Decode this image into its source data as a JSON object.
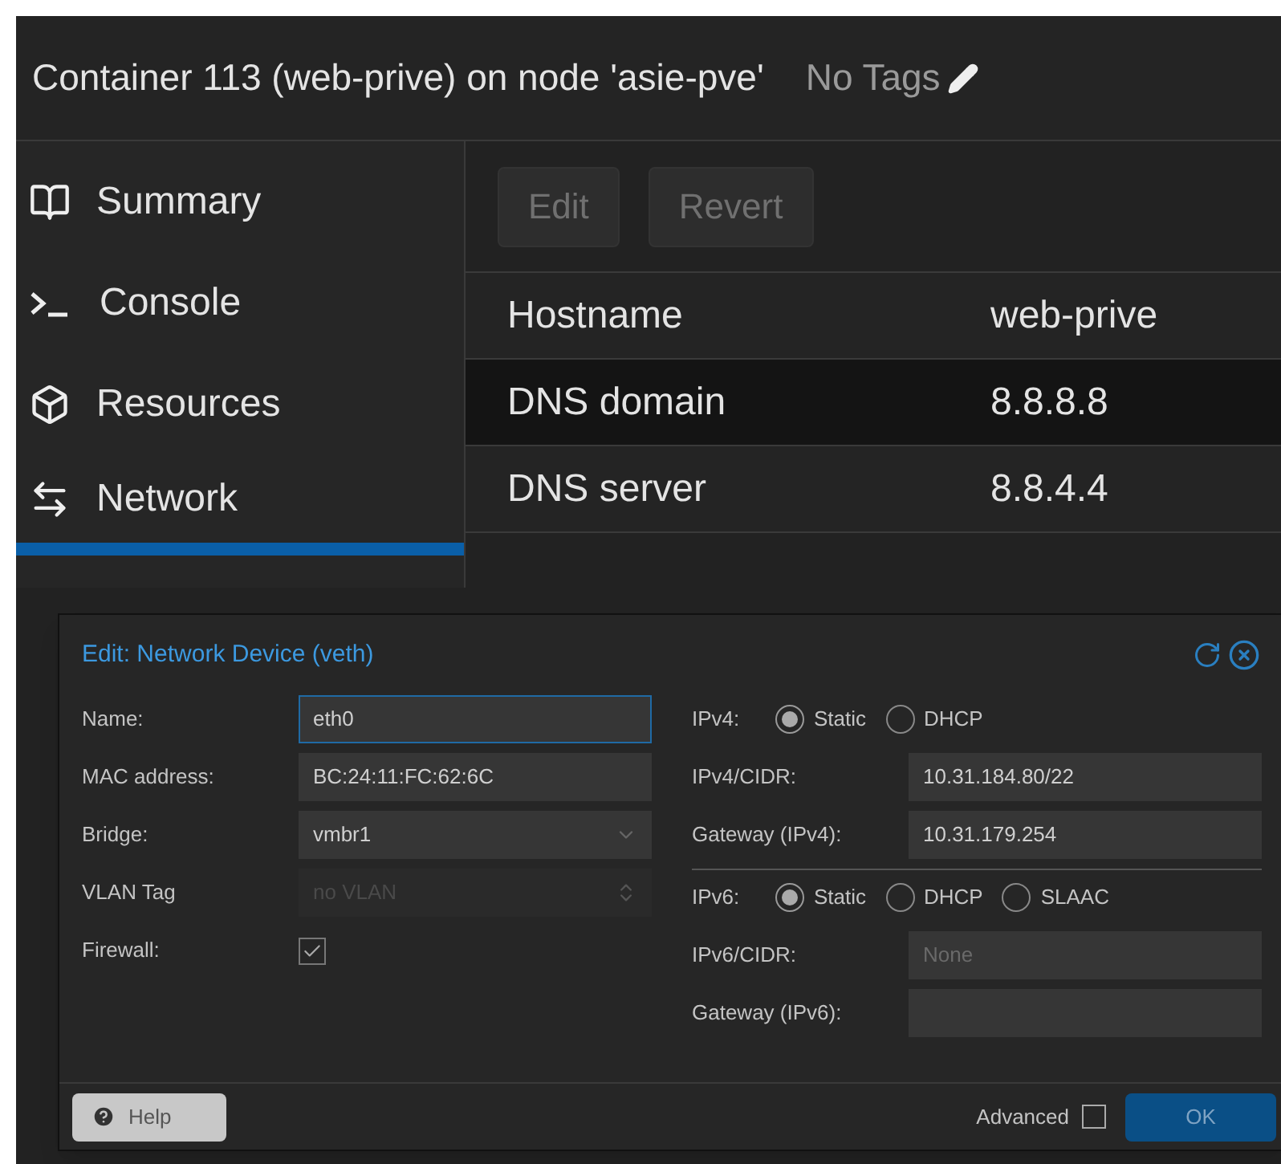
{
  "header": {
    "title": "Container 113 (web-prive) on node 'asie-pve'",
    "tags": "No Tags"
  },
  "sidebar": {
    "items": [
      {
        "label": "Summary",
        "selected": false
      },
      {
        "label": "Console",
        "selected": false
      },
      {
        "label": "Resources",
        "selected": false
      },
      {
        "label": "Network",
        "selected": true
      }
    ]
  },
  "toolbar": {
    "buttons": [
      {
        "label": "Edit",
        "disabled": true
      },
      {
        "label": "Revert",
        "disabled": true
      }
    ]
  },
  "table": {
    "rows": [
      {
        "key": "Hostname",
        "value": "web-prive",
        "selected": false
      },
      {
        "key": "DNS domain",
        "value": "8.8.8.8",
        "selected": true
      },
      {
        "key": "DNS server",
        "value": "8.8.4.4",
        "selected": false
      }
    ]
  },
  "dialog": {
    "title": "Edit: Network Device (veth)",
    "left_fields": [
      {
        "kind": "text",
        "label": "Name:",
        "value": "eth0",
        "focused": true,
        "disabled": false
      },
      {
        "kind": "text",
        "label": "MAC address:",
        "value": "BC:24:11:FC:62:6C",
        "focused": false,
        "disabled": false
      },
      {
        "kind": "select",
        "label": "Bridge:",
        "value": "vmbr1",
        "disabled": false
      },
      {
        "kind": "spinner",
        "label": "VLAN Tag",
        "placeholder": "no VLAN",
        "disabled": true
      },
      {
        "kind": "checkbox",
        "label": "Firewall:",
        "checked": true
      }
    ],
    "right_fields": [
      {
        "kind": "radio",
        "label": "IPv4:",
        "options": [
          {
            "label": "Static",
            "selected": true
          },
          {
            "label": "DHCP",
            "selected": false
          }
        ]
      },
      {
        "kind": "text",
        "label": "IPv4/CIDR:",
        "value": "10.31.184.80/22",
        "focused": false,
        "disabled": false
      },
      {
        "kind": "text",
        "label": "Gateway (IPv4):",
        "value": "10.31.179.254",
        "focused": false,
        "disabled": false
      },
      {
        "kind": "radio",
        "label": "IPv6:",
        "options": [
          {
            "label": "Static",
            "selected": true
          },
          {
            "label": "DHCP",
            "selected": false
          },
          {
            "label": "SLAAC",
            "selected": false
          }
        ]
      },
      {
        "kind": "text",
        "label": "IPv6/CIDR:",
        "placeholder": "None",
        "focused": false,
        "disabled": false
      },
      {
        "kind": "text",
        "label": "Gateway (IPv6):",
        "focused": false,
        "disabled": false
      }
    ],
    "help": "Help",
    "advanced": {
      "label": "Advanced",
      "checked": false
    },
    "ok": "OK"
  }
}
